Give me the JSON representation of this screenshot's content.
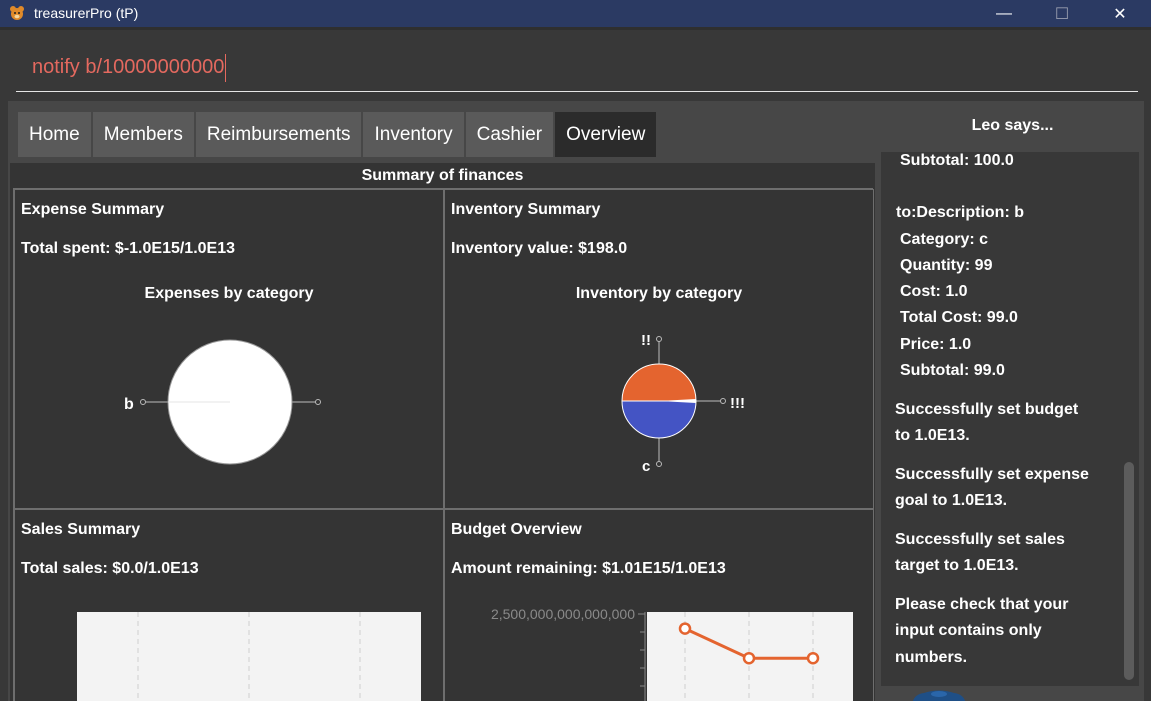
{
  "window": {
    "title": "treasurerPro (tP)",
    "minimize": "—",
    "maximize": "☐",
    "close": "✕"
  },
  "command": {
    "value": "notify b/10000000000"
  },
  "tabs": [
    "Home",
    "Members",
    "Reimbursements",
    "Inventory",
    "Cashier",
    "Overview"
  ],
  "summary": {
    "title": "Summary of finances",
    "expense": {
      "title": "Expense Summary",
      "total": "Total spent: $-1.0E15/1.0E13",
      "chart_title": "Expenses by category",
      "slice_label": "b"
    },
    "inventory": {
      "title": "Inventory Summary",
      "value": "Inventory value: $198.0",
      "chart_title": "Inventory by category",
      "labels": {
        "top": "!!",
        "right": "!!!",
        "bottom": "c"
      }
    },
    "sales": {
      "title": "Sales Summary",
      "total": "Total sales: $0.0/1.0E13"
    },
    "budget": {
      "title": "Budget Overview",
      "remaining": "Amount remaining: $1.01E15/1.0E13",
      "y_tick": "2,500,000,000,000,000"
    }
  },
  "chart_data": [
    {
      "type": "pie",
      "title": "Expenses by category",
      "slices": [
        {
          "label": "b",
          "value": 100
        }
      ],
      "colors": [
        "#ffffff"
      ]
    },
    {
      "type": "pie",
      "title": "Inventory by category",
      "slices": [
        {
          "label": "!!",
          "value": 99,
          "color": "#e4642f"
        },
        {
          "label": "!!!",
          "value": 1,
          "color": "#ffffff"
        },
        {
          "label": "c",
          "value": 99,
          "color": "#4454c4"
        }
      ]
    },
    {
      "type": "line",
      "title": "Budget Overview",
      "ytick": "2,500,000,000,000,000",
      "series": [
        {
          "values": [
            2.2,
            1.4,
            1.4
          ]
        }
      ],
      "color": "#e4642f"
    }
  ],
  "side": {
    "title": "Leo says...",
    "lines": [
      "Subtotal: 100.0",
      "to:Description: b",
      "Category: c",
      "Quantity: 99",
      "Cost: 1.0",
      "Total Cost: 99.0",
      "Price: 1.0",
      "Subtotal: 99.0",
      "Successfully set budget",
      "to 1.0E13.",
      "Successfully set expense",
      "goal to 1.0E13.",
      "Successfully set sales",
      "target to 1.0E13.",
      "Please check that your",
      "input contains only",
      "numbers."
    ]
  }
}
